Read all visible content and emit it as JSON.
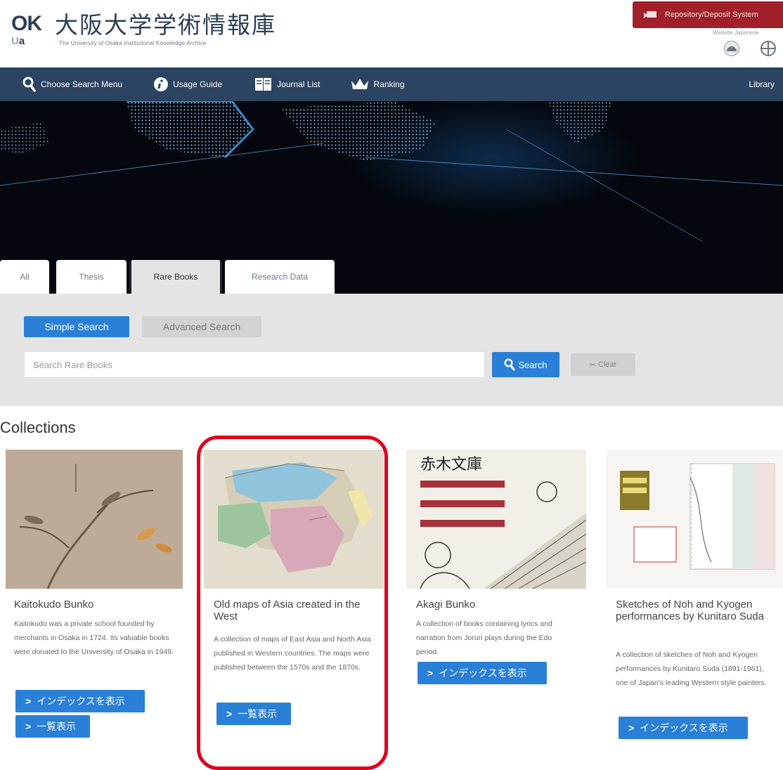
{
  "header": {
    "logo_ok": "OK",
    "logo_u": "U",
    "logo_a": "a",
    "logo_jp": "大阪大学学術情報庫",
    "logo_en": "The University of Osaka Institutional Knowledge Archive",
    "deposit_button": "Repository/Deposit System",
    "lang_labels": "Website  Japanese"
  },
  "nav": {
    "items": [
      {
        "label": "Choose Search Menu",
        "icon": "search-icon"
      },
      {
        "label": "Usage Guide",
        "icon": "info-icon"
      },
      {
        "label": "Journal List",
        "icon": "journal-icon"
      },
      {
        "label": "Ranking",
        "icon": "crown-icon"
      }
    ],
    "library": "Library"
  },
  "tabs": [
    "All",
    "Thesis",
    "Rare Books",
    "Research Data"
  ],
  "search": {
    "simple": "Simple Search",
    "advanced": "Advanced Search",
    "placeholder": "Search Rare Books",
    "search_button": "Search",
    "clear_button": "Clear"
  },
  "collections": {
    "title": "Collections",
    "cards": [
      {
        "title": "Kaitokudo Bunko",
        "description": "Kaitokudo was a private school founded by merchants in Osaka in 1724. Its valuable books were donated to the University of Osaka in 1949.",
        "buttons": [
          "インデックスを表示",
          "一覧表示"
        ]
      },
      {
        "title": "Old maps of Asia created in the West",
        "description": "A collection of maps of East Asia and North Asia published in Western countries. The maps were published between the 1570s and the 1870s.",
        "buttons": [
          "一覧表示"
        ]
      },
      {
        "title": "Akagi Bunko",
        "image_text": "赤木文庫",
        "description": "A collection of books containing lyrics and narration from Joruri plays during the Edo period.",
        "buttons": [
          "インデックスを表示"
        ]
      },
      {
        "title": "Sketches of Noh and Kyogen performances by Kunitaro Suda",
        "description": "A collection of sketches of Noh and Kyogen performances by Kunitaro Suda (1891-1961), one of Japan's leading Western style painters.",
        "buttons": [
          "インデックスを表示"
        ]
      }
    ]
  },
  "colors": {
    "nav_bg": "#2a4461",
    "accent_blue": "#2a80d6",
    "deposit_red": "#a2202a",
    "highlight_red": "#e0001a"
  }
}
